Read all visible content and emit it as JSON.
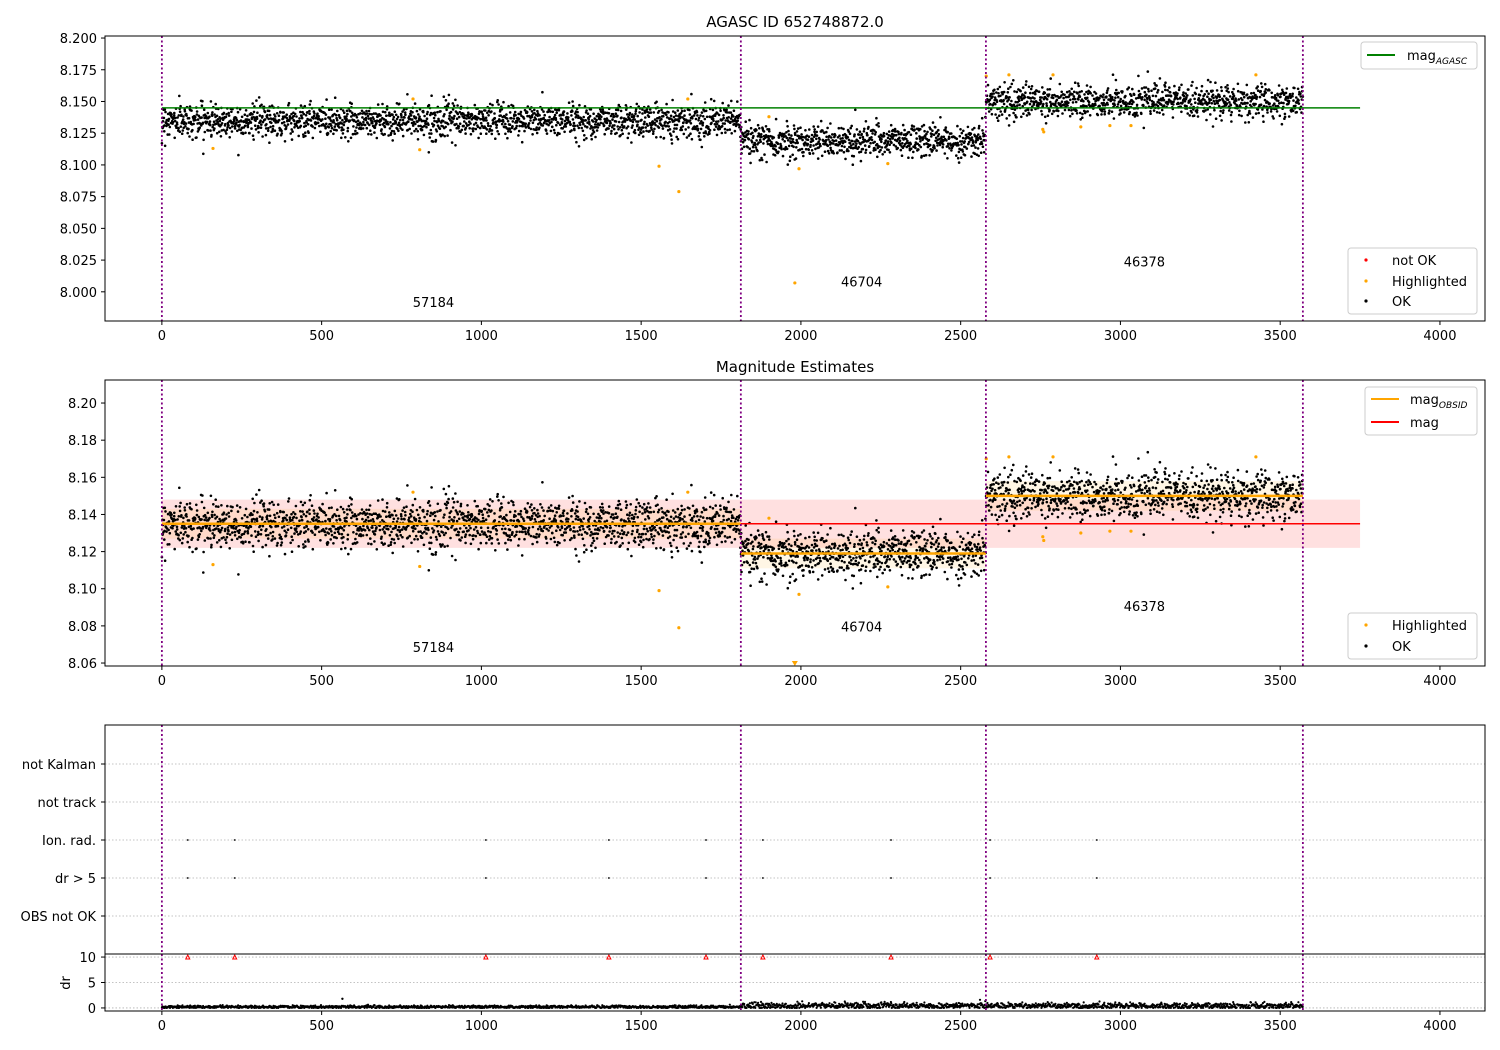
{
  "chart_data": {
    "type": "scatter",
    "xlim": [
      -178,
      4141
    ],
    "xticks": [
      0,
      500,
      1000,
      1500,
      2000,
      2500,
      3000,
      3500,
      4000
    ],
    "obsid_boundaries": [
      0,
      1812,
      2579,
      3571
    ],
    "obsids": [
      {
        "obsid": "57184",
        "start": 0,
        "end": 1812,
        "mag_obsid": 8.135,
        "std": 0.0065,
        "label_x": 850
      },
      {
        "obsid": "46704",
        "start": 1812,
        "end": 2579,
        "mag_obsid": 8.119,
        "std": 0.0065,
        "label_x": 2190
      },
      {
        "obsid": "46378",
        "start": 2579,
        "end": 3571,
        "mag_obsid": 8.15,
        "std": 0.0065,
        "label_x": 3075
      }
    ],
    "highlighted": [
      [
        160,
        8.113
      ],
      [
        786,
        8.152
      ],
      [
        807,
        8.112
      ],
      [
        1556,
        8.099
      ],
      [
        1618,
        8.079
      ],
      [
        1646,
        8.152
      ],
      [
        1900,
        8.138
      ],
      [
        1994,
        8.097
      ],
      [
        1981,
        8.007
      ],
      [
        2272,
        8.101
      ],
      [
        2580,
        8.17
      ],
      [
        2651,
        8.171
      ],
      [
        2757,
        8.128
      ],
      [
        2760,
        8.126
      ],
      [
        2789,
        8.171
      ],
      [
        2876,
        8.13
      ],
      [
        2967,
        8.131
      ],
      [
        3033,
        8.131
      ],
      [
        3424,
        8.171
      ]
    ],
    "panels": [
      {
        "title": "AGASC ID 652748872.0",
        "ylim": [
          7.977,
          8.2016
        ],
        "yticks": [
          "8.000",
          "8.025",
          "8.050",
          "8.075",
          "8.100",
          "8.125",
          "8.150",
          "8.175",
          "8.200"
        ],
        "obsid_label_y": [
          7.988,
          8.004,
          8.02
        ],
        "mag_agasc": 8.145,
        "line_extent": [
          0,
          3750
        ],
        "legend_top": {
          "label": "mag",
          "sub": "AGASC",
          "color": "#008000"
        },
        "legend_bottom": [
          {
            "label": "not OK",
            "color": "#ff0000"
          },
          {
            "label": "Highlighted",
            "color": "#ffa500"
          },
          {
            "label": "OK",
            "color": "#000000"
          }
        ]
      },
      {
        "title": "Magnitude Estimates",
        "ylim": [
          8.0584,
          8.2124
        ],
        "yticks": [
          "8.06",
          "8.08",
          "8.10",
          "8.12",
          "8.14",
          "8.16",
          "8.18",
          "8.20"
        ],
        "obsid_label_y": [
          8.066,
          8.077,
          8.088
        ],
        "mag": 8.135,
        "mag_band": [
          8.122,
          8.148
        ],
        "line_extent": [
          0,
          3750
        ],
        "legend_top": [
          {
            "label": "mag",
            "sub": "OBSID",
            "color": "#ffa500"
          },
          {
            "label": "mag",
            "sub": "",
            "color": "#ff0000"
          }
        ],
        "legend_bottom": [
          {
            "label": "Highlighted",
            "color": "#ffa500"
          },
          {
            "label": "OK",
            "color": "#000000"
          }
        ]
      },
      {
        "flag_rows": [
          "not Kalman",
          "not track",
          "Ion. rad.",
          "dr > 5",
          "OBS not OK"
        ],
        "flag_events": {
          "Ion. rad.": [
            81,
            228,
            1014,
            1399,
            1703,
            1881,
            2282,
            2592,
            2926
          ],
          "dr > 5": [
            81,
            228,
            1014,
            1399,
            1703,
            1881,
            2282,
            2592,
            2926
          ]
        },
        "dr_ylabel": "dr",
        "dr_ylim": [
          -0.6,
          10.6
        ],
        "dr_yticks": [
          "0",
          "5",
          "10"
        ],
        "dr_clipped_value": 10,
        "dr_baseline": [
          {
            "start": 0,
            "end": 1812,
            "mean": 0.2
          },
          {
            "start": 1812,
            "end": 2579,
            "mean": 0.45
          },
          {
            "start": 2579,
            "end": 3571,
            "mean": 0.4
          }
        ],
        "dr_outlier": [
          565,
          1.8
        ]
      }
    ]
  }
}
